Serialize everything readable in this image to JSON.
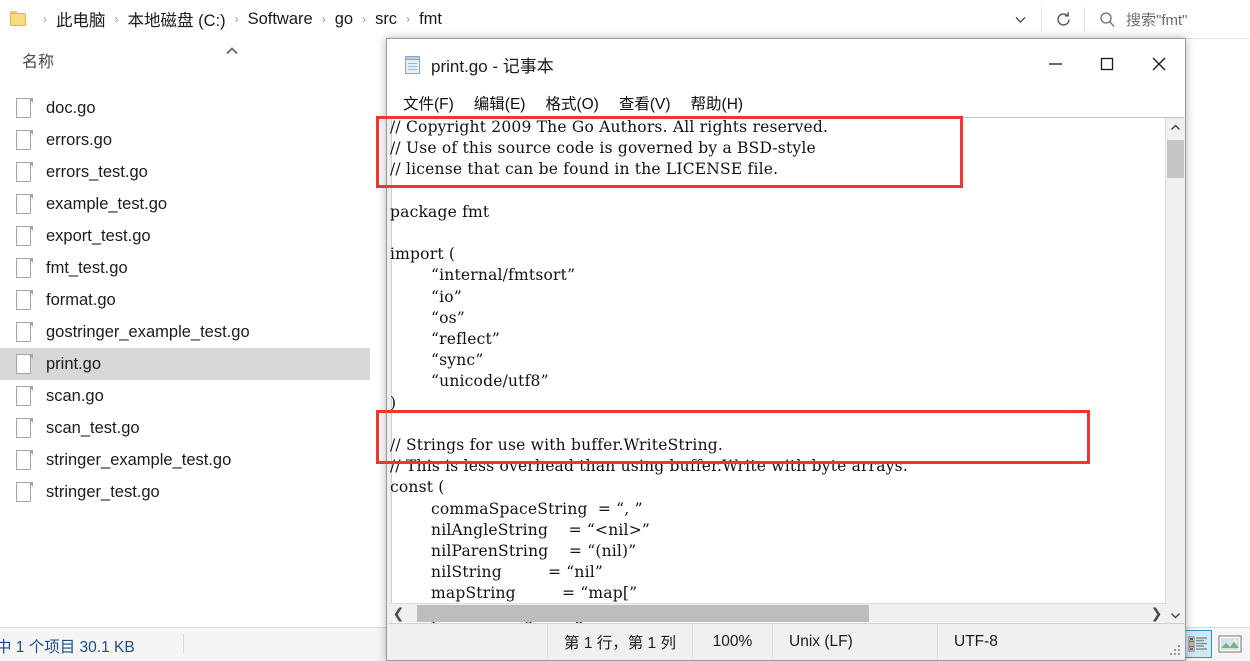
{
  "explorer": {
    "address_bar": {
      "folder_icon": "folder-icon",
      "breadcrumbs": [
        "此电脑",
        "本地磁盘 (C:)",
        "Software",
        "go",
        "src",
        "fmt"
      ],
      "separator": "›",
      "history_dropdown_icon": "chevron-down-icon",
      "refresh_icon": "refresh-icon",
      "search_icon": "search-icon",
      "search_placeholder": "搜索\"fmt\""
    },
    "column_header": {
      "name_label": "名称",
      "sort_icon": "chevron-up-icon"
    },
    "files": [
      {
        "name": "doc.go",
        "selected": false
      },
      {
        "name": "errors.go",
        "selected": false
      },
      {
        "name": "errors_test.go",
        "selected": false
      },
      {
        "name": "example_test.go",
        "selected": false
      },
      {
        "name": "export_test.go",
        "selected": false
      },
      {
        "name": "fmt_test.go",
        "selected": false
      },
      {
        "name": "format.go",
        "selected": false
      },
      {
        "name": "gostringer_example_test.go",
        "selected": false
      },
      {
        "name": "print.go",
        "selected": true
      },
      {
        "name": "scan.go",
        "selected": false
      },
      {
        "name": "scan_test.go",
        "selected": false
      },
      {
        "name": "stringer_example_test.go",
        "selected": false
      },
      {
        "name": "stringer_test.go",
        "selected": false
      }
    ],
    "status_bar": {
      "selection_text": "中 1 个项目  30.1 KB",
      "details_view_icon": "details-view-icon",
      "large_icons_view_icon": "large-icons-view-icon"
    }
  },
  "notepad": {
    "app_icon": "notepad-icon",
    "title": "print.go - 记事本",
    "window_controls": {
      "minimize": "minimize-icon",
      "maximize": "maximize-icon",
      "close": "close-icon"
    },
    "menu": [
      "文件(F)",
      "编辑(E)",
      "格式(O)",
      "查看(V)",
      "帮助(H)"
    ],
    "editor_text": "// Copyright 2009 The Go Authors. All rights reserved.\n// Use of this source code is governed by a BSD-style\n// license that can be found in the LICENSE file.\n\npackage fmt\n\nimport (\n        “internal/fmtsort”\n        “io”\n        “os”\n        “reflect”\n        “sync”\n        “unicode/utf8”\n)\n\n// Strings for use with buffer.WriteString.\n// This is less overhead than using buffer.Write with byte arrays.\nconst (\n        commaSpaceString  = “, ”\n        nilAngleString    = “<nil>”\n        nilParenString    = “(nil)”\n        nilString         = “nil”\n        mapString         = “map[”\n        percentBangString = “%!”",
    "scrollbars": {
      "v_up_icon": "chevron-up-icon",
      "v_down_icon": "chevron-down-icon",
      "h_left_icon": "chevron-left-icon",
      "h_right_icon": "chevron-right-icon"
    },
    "status_bar": {
      "position": "第 1 行，第 1 列",
      "zoom": "100%",
      "line_ending": "Unix (LF)",
      "encoding": "UTF-8"
    }
  },
  "annotations": {
    "accent_color": "#f03434",
    "boxes": [
      {
        "label": "copyright-comment-highlight"
      },
      {
        "label": "strings-comment-highlight"
      }
    ]
  }
}
